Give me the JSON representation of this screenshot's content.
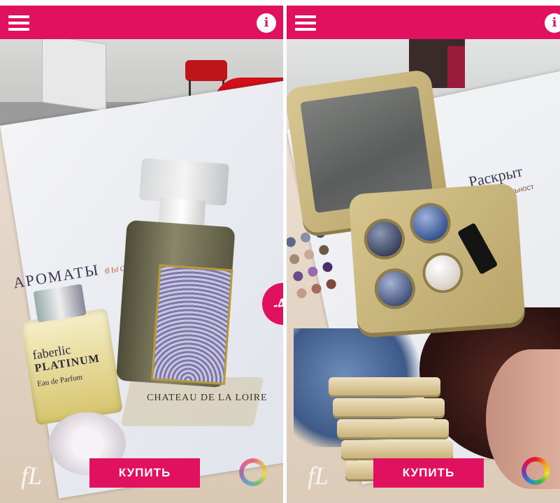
{
  "screens": [
    {
      "buy_label": "КУПИТЬ",
      "info_icon": "info-icon",
      "menu_icon": "hamburger-menu-icon",
      "magazine": {
        "heading": "АРОМАТЫ",
        "heading_accent": "высше",
        "bottle_brand": "faberlic",
        "bottle_name": "PLATINUM",
        "bottle_sub": "Eau de Parfum",
        "ar_label": "CHATEAU DE LA LOIRE",
        "sale_text": "-40"
      },
      "logo": "fL"
    },
    {
      "buy_label": "КУПИТЬ",
      "info_icon": "info-icon",
      "menu_icon": "hamburger-menu-icon",
      "magazine": {
        "heading": "Раскрыт",
        "subheading": "выразительност"
      },
      "logo": "fL"
    }
  ],
  "colors": {
    "brand_pink": "#e0115f",
    "white": "#ffffff"
  }
}
